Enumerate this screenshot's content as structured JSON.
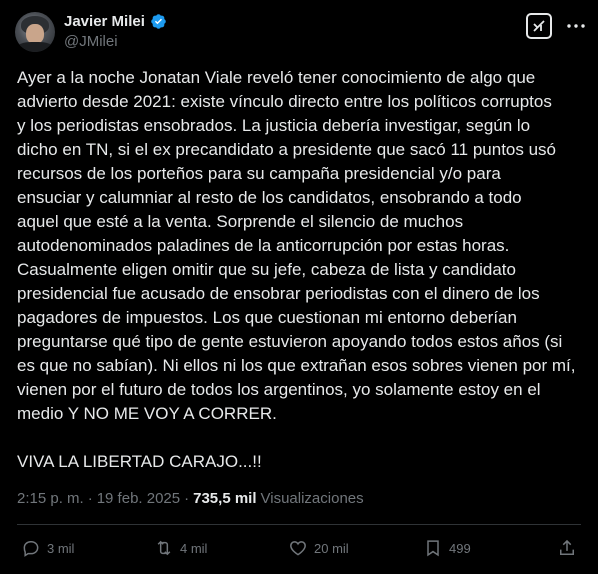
{
  "author": {
    "display_name": "Javier Milei",
    "handle": "@JMilei"
  },
  "post": {
    "text": "Ayer a la noche Jonatan Viale reveló tener conocimiento de algo que\nadvierto desde 2021: existe vínculo directo entre los políticos corruptos\ny los periodistas ensobrados. La justicia debería investigar, según lo\ndicho en TN, si el ex precandidato a presidente que sacó 11 puntos usó\nrecursos de los porteños para su campaña presidencial y/o para\nensuciar y calumniar al resto de los candidatos, ensobrando a todo\naquel que esté a la venta. Sorprende el silencio de muchos\nautodenominados paladines de la anticorrupción por estas horas.\nCasualmente eligen omitir que su jefe, cabeza de lista y candidato\npresidencial fue acusado de ensobrar periodistas con el dinero de los\npagadores de impuestos. Los que cuestionan mi entorno deberían\npreguntarse qué tipo de gente estuvieron apoyando todos estos años (si\nes que no sabían). Ni ellos ni los que extrañan esos sobres vienen por mí,\nvienen por el futuro de todos los argentinos, yo solamente estoy en el\nmedio Y NO ME VOY A CORRER.\n\nVIVA LA LIBERTAD CARAJO...!!",
    "time": "2:15 p. m.",
    "separator": "·",
    "date": "19 feb. 2025",
    "views_count": "735,5 mil",
    "views_label": "Visualizaciones"
  },
  "actions": {
    "replies": "3 mil",
    "reposts": "4 mil",
    "likes": "20 mil",
    "bookmarks": "499"
  },
  "icons": [
    "avatar",
    "verified-badge-icon",
    "grok-icon",
    "more-icon",
    "reply-icon",
    "repost-icon",
    "like-icon",
    "bookmark-icon",
    "share-icon"
  ],
  "colors": {
    "background": "#000000",
    "text": "#e7e9ea",
    "muted": "#71767b",
    "verified": "#1d9bf0"
  }
}
